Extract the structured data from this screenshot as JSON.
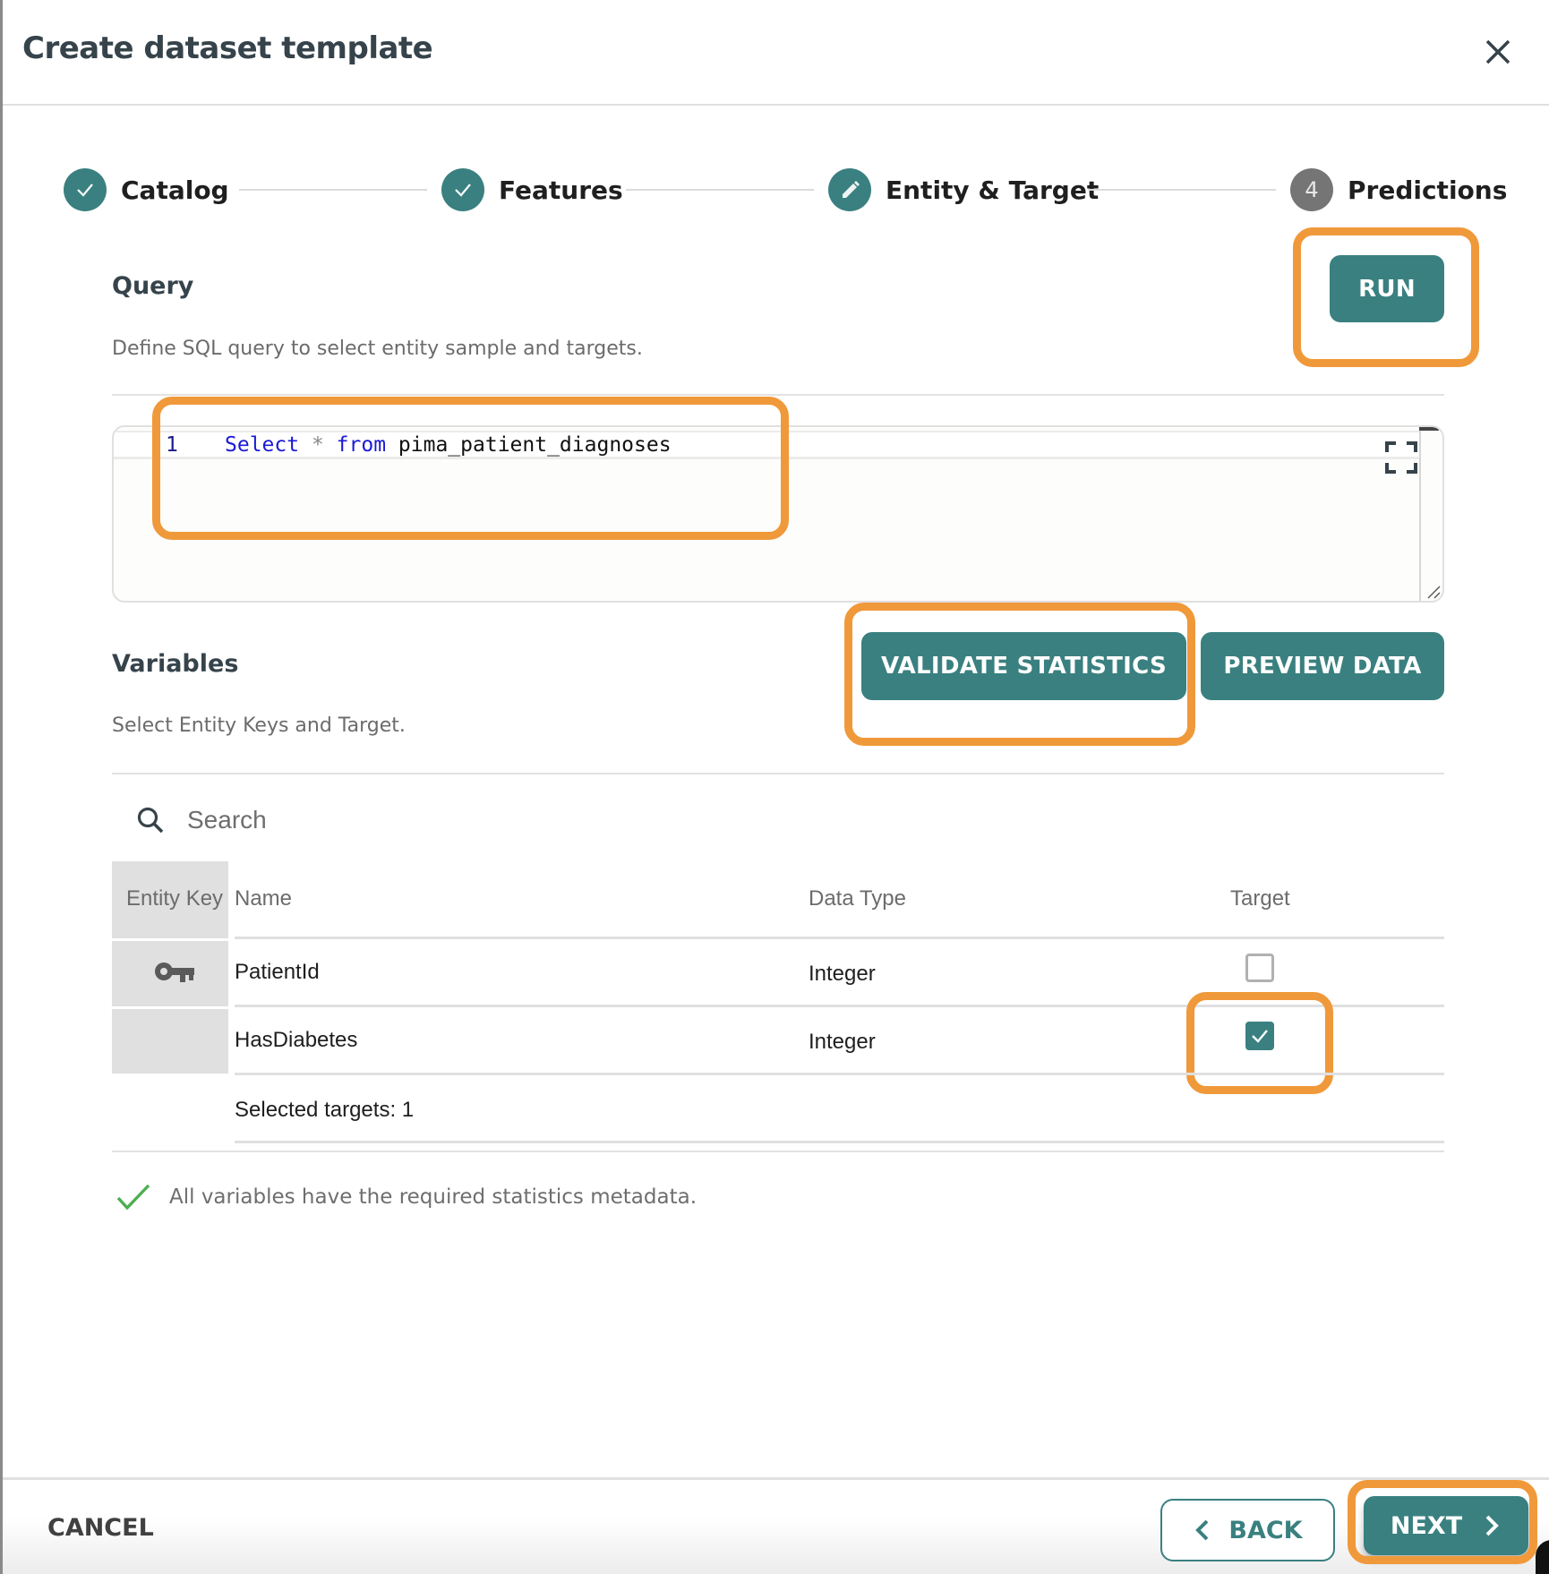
{
  "dialog": {
    "title": "Create dataset template",
    "close_icon": "close-icon"
  },
  "stepper": {
    "steps": [
      {
        "label": "Catalog",
        "state": "completed",
        "icon": "check-icon"
      },
      {
        "label": "Features",
        "state": "completed",
        "icon": "check-icon"
      },
      {
        "label": "Entity & Target",
        "state": "active",
        "icon": "pencil-icon"
      },
      {
        "label": "Predictions",
        "state": "pending",
        "number": "4"
      }
    ]
  },
  "query": {
    "title": "Query",
    "subtitle": "Define SQL query to select entity sample and targets.",
    "run_label": "RUN",
    "editor": {
      "line_number": "1",
      "code_keyword_1": "Select",
      "code_operator": "*",
      "code_keyword_2": "from",
      "code_table": "pima_patient_diagnoses"
    }
  },
  "variables": {
    "title": "Variables",
    "subtitle": "Select Entity Keys and Target.",
    "validate_label": "VALIDATE STATISTICS",
    "preview_label": "PREVIEW DATA",
    "search_placeholder": "Search",
    "columns": {
      "entity_key": "Entity Key",
      "name": "Name",
      "data_type": "Data Type",
      "target": "Target"
    },
    "rows": [
      {
        "entity_key": true,
        "name": "PatientId",
        "data_type": "Integer",
        "target": false
      },
      {
        "entity_key": false,
        "name": "HasDiabetes",
        "data_type": "Integer",
        "target": true
      }
    ],
    "selected_targets": "Selected targets: 1",
    "validation_message": "All variables have the required statistics metadata."
  },
  "footer": {
    "cancel_label": "CANCEL",
    "back_label": "BACK",
    "next_label": "NEXT"
  },
  "colors": {
    "accent": "#3a8080",
    "highlight": "#f0993a",
    "pending_step": "#757575",
    "success": "#4caf50"
  }
}
